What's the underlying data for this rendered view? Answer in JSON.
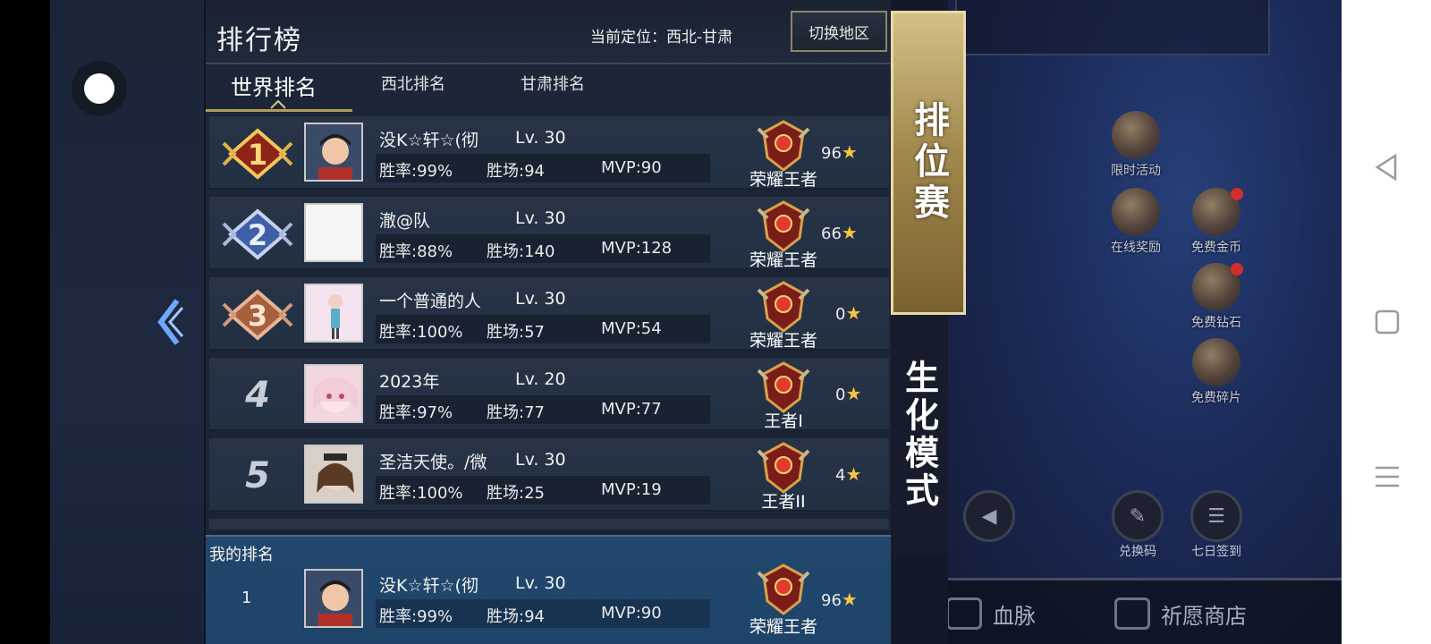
{
  "header": {
    "title": "排行榜",
    "location": "当前定位：西北-甘肃",
    "switch_region": "切换地区"
  },
  "tabs": [
    {
      "label": "世界排名",
      "active": true
    },
    {
      "label": "西北排名",
      "active": false
    },
    {
      "label": "甘肃排名",
      "active": false
    }
  ],
  "rows": [
    {
      "rank": "1",
      "name": "没K☆轩☆(彻",
      "level": "Lv. 30",
      "winrate": "胜率:99%",
      "wins": "胜场:94",
      "mvp": "MVP:90",
      "tier": "荣耀王者",
      "stars": "96"
    },
    {
      "rank": "2",
      "name": "澈@队",
      "level": "Lv. 30",
      "winrate": "胜率:88%",
      "wins": "胜场:140",
      "mvp": "MVP:128",
      "tier": "荣耀王者",
      "stars": "66"
    },
    {
      "rank": "3",
      "name": "一个普通的人",
      "level": "Lv. 30",
      "winrate": "胜率:100%",
      "wins": "胜场:57",
      "mvp": "MVP:54",
      "tier": "荣耀王者",
      "stars": "0"
    },
    {
      "rank": "4",
      "name": "2023年",
      "level": "Lv. 20",
      "winrate": "胜率:97%",
      "wins": "胜场:77",
      "mvp": "MVP:77",
      "tier": "王者I",
      "stars": "0"
    },
    {
      "rank": "5",
      "name": "圣洁天使。/微",
      "level": "Lv. 30",
      "winrate": "胜率:100%",
      "wins": "胜场:25",
      "mvp": "MVP:19",
      "tier": "王者II",
      "stars": "4"
    }
  ],
  "my_ranking": {
    "label": "我的排名",
    "rank": "1",
    "name": "没K☆轩☆(彻",
    "level": "Lv. 30",
    "winrate": "胜率:99%",
    "wins": "胜场:94",
    "mvp": "MVP:90",
    "tier": "荣耀王者",
    "stars": "96"
  },
  "modes": {
    "ranked": "排位赛",
    "bio": "生化模式"
  },
  "right_side": {
    "icons": [
      "限时活动",
      "在线奖励",
      "免费金币",
      "免费钻石",
      "免费碎片",
      "兑换码",
      "七日签到"
    ],
    "bottom_tabs": [
      "血脉",
      "祈愿商店"
    ]
  },
  "colors": {
    "gold": "#b59a5d",
    "panel": "#1c2637",
    "my_row": "#22476d"
  }
}
